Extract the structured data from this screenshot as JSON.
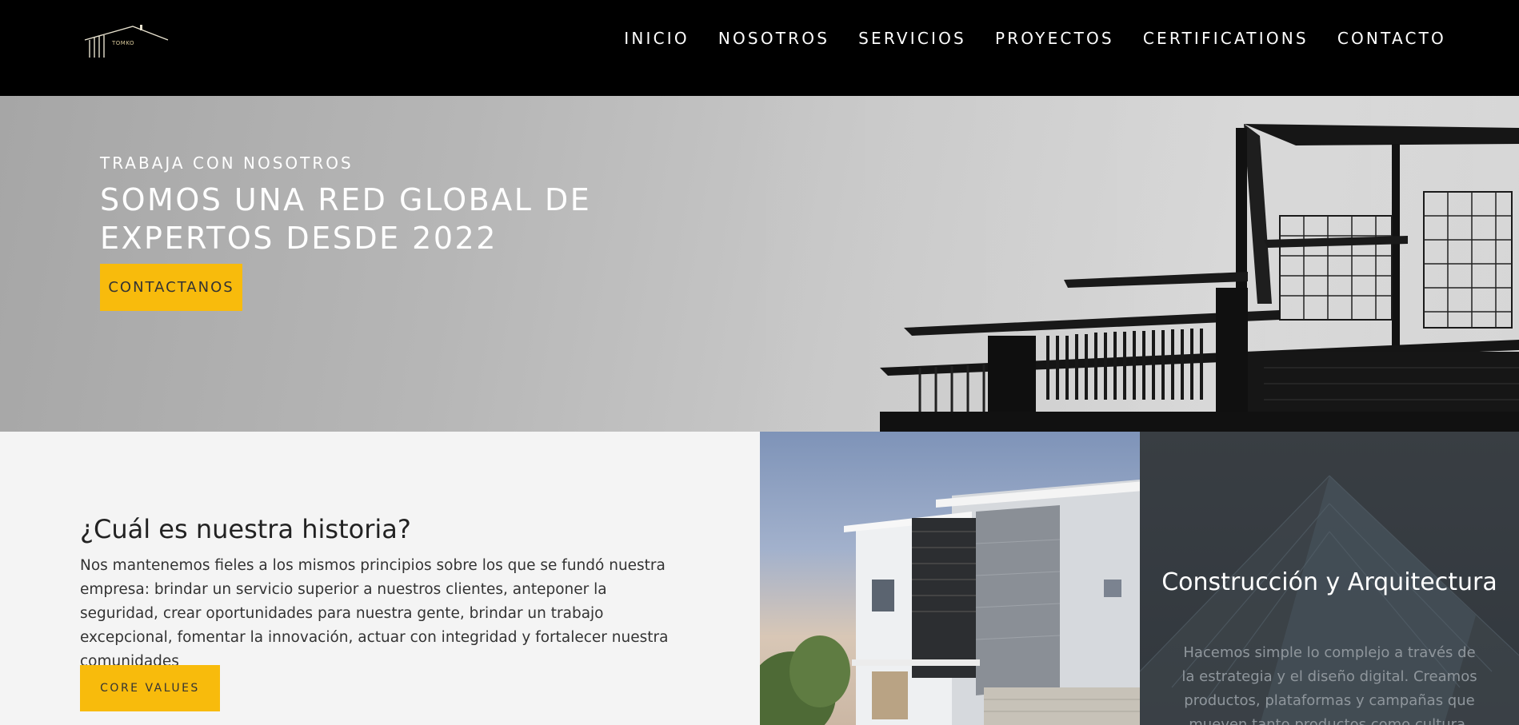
{
  "brand": {
    "logo_text": "TOMKO"
  },
  "nav": {
    "items": [
      "INICIO",
      "NOSOTROS",
      "SERVICIOS",
      "PROYECTOS",
      "CERTIFICATIONS",
      "CONTACTO"
    ]
  },
  "hero": {
    "eyebrow": "TRABAJA CON NOSOTROS",
    "title": "SOMOS UNA RED GLOBAL DE EXPERTOS DESDE 2022",
    "cta_label": "CONTACTANOS"
  },
  "story": {
    "title": "¿Cuál es nuestra historia?",
    "text": "Nos mantenemos fieles a los mismos principios sobre los que se fundó nuestra empresa: brindar un servicio superior a nuestros clientes, anteponer la seguridad, crear oportunidades para nuestra gente, brindar un trabajo excepcional, fomentar la innovación, actuar con integridad y fortalecer nuestra comunidades",
    "button_label": "CORE VALUES"
  },
  "service": {
    "title": "Construcción y Arquitectura",
    "text": "Hacemos simple lo complejo a través de la estrategia y el diseño digital. Creamos productos, plataformas y campañas que mueven tanto productos como cultura."
  },
  "colors": {
    "accent": "#f8bb0c",
    "navbar_bg": "#000000",
    "story_bg": "#f4f4f4",
    "service_bg": "#3b4046"
  },
  "icons": {
    "logo": "house-roof-logo-icon"
  }
}
